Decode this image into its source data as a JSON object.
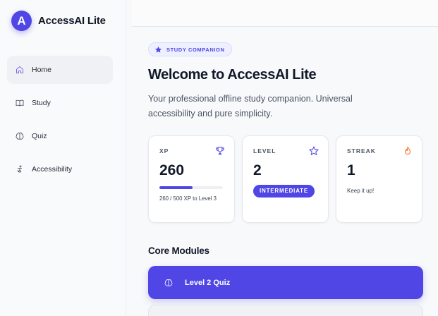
{
  "app": {
    "logo_letter": "A",
    "name": "AccessAI Lite"
  },
  "sidebar": {
    "items": [
      {
        "label": "Home",
        "icon": "home-icon",
        "active": true
      },
      {
        "label": "Study",
        "icon": "book-icon",
        "active": false
      },
      {
        "label": "Quiz",
        "icon": "brain-icon",
        "active": false
      },
      {
        "label": "Accessibility",
        "icon": "accessibility-icon",
        "active": false
      }
    ]
  },
  "hero": {
    "badge": "STUDY COMPANION",
    "title": "Welcome to AccessAI Lite",
    "subtitle": "Your professional offline study companion. Universal accessibility and pure simplicity."
  },
  "stats": {
    "xp": {
      "label": "XP",
      "value": "260",
      "note": "260 / 500 XP to Level 3",
      "progress": 0.52,
      "icon": "trophy-icon"
    },
    "level": {
      "label": "LEVEL",
      "value": "2",
      "tier": "INTERMEDIATE",
      "icon": "star-icon"
    },
    "streak": {
      "label": "STREAK",
      "value": "1",
      "note": "Keep it up!",
      "icon": "flame-icon"
    }
  },
  "modules": {
    "title": "Core Modules",
    "items": [
      {
        "label": "Level 2 Quiz",
        "icon": "brain-icon"
      }
    ]
  },
  "colors": {
    "accent": "#4f46e5",
    "streak": "#f97316"
  }
}
